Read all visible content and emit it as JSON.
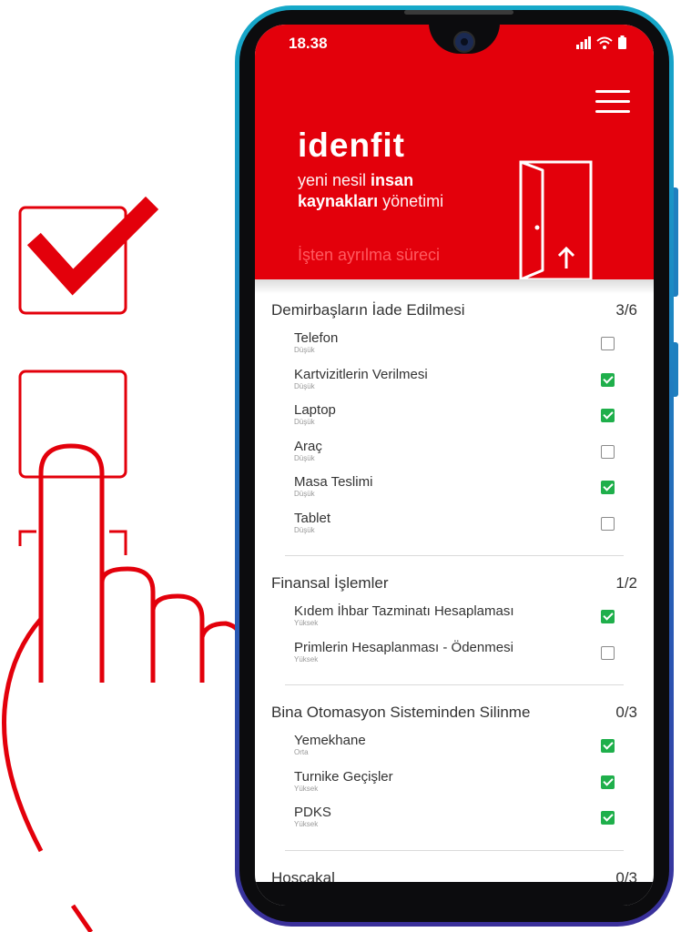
{
  "status_bar": {
    "time": "18.38"
  },
  "header": {
    "logo": "idenfit",
    "tagline_parts": [
      "yeni nesil ",
      "insan",
      "kaynakları",
      " yönetimi"
    ],
    "process_title": "İşten ayrılma süreci"
  },
  "colors": {
    "brand": "#e3000b",
    "check": "#1faf4b"
  },
  "sections": [
    {
      "title": "Demirbaşların İade Edilmesi",
      "count": "3/6",
      "items": [
        {
          "title": "Telefon",
          "priority": "Düşük",
          "checked": false
        },
        {
          "title": "Kartvizitlerin Verilmesi",
          "priority": "Düşük",
          "checked": true
        },
        {
          "title": "Laptop",
          "priority": "Düşük",
          "checked": true
        },
        {
          "title": "Araç",
          "priority": "Düşük",
          "checked": false
        },
        {
          "title": "Masa Teslimi",
          "priority": "Düşük",
          "checked": true
        },
        {
          "title": "Tablet",
          "priority": "Düşük",
          "checked": false
        }
      ]
    },
    {
      "title": "Finansal İşlemler",
      "count": "1/2",
      "items": [
        {
          "title": "Kıdem İhbar Tazminatı Hesaplaması",
          "priority": "Yüksek",
          "checked": true
        },
        {
          "title": "Primlerin Hesaplanması - Ödenmesi",
          "priority": "Yüksek",
          "checked": false
        }
      ]
    },
    {
      "title": "Bina Otomasyon Sisteminden Silinme",
      "count": "0/3",
      "items": [
        {
          "title": "Yemekhane",
          "priority": "Orta",
          "checked": true
        },
        {
          "title": "Turnike Geçişler",
          "priority": "Yüksek",
          "checked": true
        },
        {
          "title": "PDKS",
          "priority": "Yüksek",
          "checked": true
        }
      ]
    },
    {
      "title": "Hoşçakal",
      "count": "0/3",
      "items": []
    }
  ]
}
